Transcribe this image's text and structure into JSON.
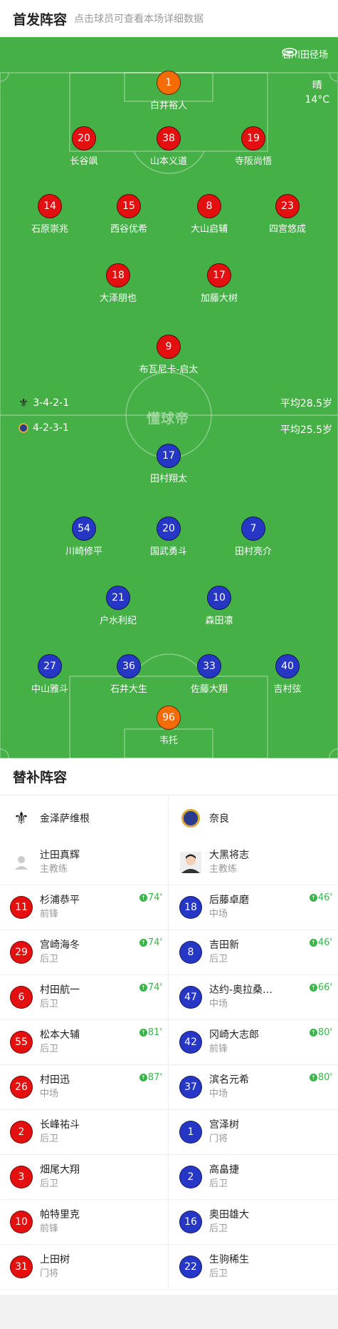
{
  "header": {
    "title": "首发阵容",
    "subtitle": "点击球员可查看本场详细数据"
  },
  "match": {
    "venue": "石川田径场",
    "weather": "晴",
    "temp": "14°C",
    "watermark": "懂球帝"
  },
  "home": {
    "formation": "3-4-2-1",
    "avg_age": "平均28.5岁"
  },
  "away": {
    "formation": "4-2-3-1",
    "avg_age": "平均25.5岁"
  },
  "home_players": [
    {
      "num": "1",
      "name": "白井裕人",
      "gk": true
    },
    {
      "num": "20",
      "name": "长谷飒",
      "sub": "81'",
      "goal": true
    },
    {
      "num": "38",
      "name": "山本义道",
      "captain": true
    },
    {
      "num": "19",
      "name": "寺阪尚悟"
    },
    {
      "num": "14",
      "name": "石原崇兆",
      "sub": "74'"
    },
    {
      "num": "15",
      "name": "西谷优希"
    },
    {
      "num": "8",
      "name": "大山启辅",
      "sub": "87'",
      "goal": true
    },
    {
      "num": "23",
      "name": "四宫悠成"
    },
    {
      "num": "18",
      "name": "大泽朋也",
      "sub": "74'"
    },
    {
      "num": "17",
      "name": "加藤大树",
      "sub": "74'"
    },
    {
      "num": "9",
      "name": "布瓦尼卡-启太"
    }
  ],
  "away_players": [
    {
      "num": "17",
      "name": "田村翔太",
      "sub": "80'"
    },
    {
      "num": "54",
      "name": "川崎修平",
      "sub": "80'"
    },
    {
      "num": "20",
      "name": "国武勇斗"
    },
    {
      "num": "7",
      "name": "田村亮介",
      "sub": "66'"
    },
    {
      "num": "21",
      "name": "户水利纪",
      "sub": "46'"
    },
    {
      "num": "10",
      "name": "森田凛",
      "captain": true
    },
    {
      "num": "27",
      "name": "中山雅斗",
      "sub": "46'"
    },
    {
      "num": "36",
      "name": "石井大生"
    },
    {
      "num": "33",
      "name": "佐藤大翔"
    },
    {
      "num": "40",
      "name": "吉村弦"
    },
    {
      "num": "96",
      "name": "韦托",
      "gk": true
    }
  ],
  "subs": {
    "title": "替补阵容",
    "home_team": "金泽萨维根",
    "away_team": "奈良",
    "home_coach": {
      "name": "辻田真辉",
      "role": "主教练"
    },
    "away_coach": {
      "name": "大黑将志",
      "role": "主教练"
    },
    "home": [
      {
        "num": "11",
        "name": "杉浦恭平",
        "pos": "前锋",
        "time": "74'"
      },
      {
        "num": "29",
        "name": "宫崎海冬",
        "pos": "后卫",
        "time": "74'"
      },
      {
        "num": "6",
        "name": "村田航一",
        "pos": "后卫",
        "time": "74'"
      },
      {
        "num": "55",
        "name": "松本大辅",
        "pos": "后卫",
        "time": "81'"
      },
      {
        "num": "26",
        "name": "村田迅",
        "pos": "中场",
        "time": "87'"
      },
      {
        "num": "2",
        "name": "长峰祐斗",
        "pos": "后卫"
      },
      {
        "num": "3",
        "name": "畑尾大翔",
        "pos": "后卫"
      },
      {
        "num": "10",
        "name": "帕特里克",
        "pos": "前锋"
      },
      {
        "num": "31",
        "name": "上田树",
        "pos": "门将"
      }
    ],
    "away": [
      {
        "num": "18",
        "name": "后藤卓磨",
        "pos": "中场",
        "time": "46'"
      },
      {
        "num": "8",
        "name": "吉田新",
        "pos": "后卫",
        "time": "46'"
      },
      {
        "num": "47",
        "name": "达约-奥拉桑…",
        "pos": "中场",
        "time": "66'"
      },
      {
        "num": "42",
        "name": "冈崎大志郎",
        "pos": "前锋",
        "time": "80'"
      },
      {
        "num": "37",
        "name": "滨名元希",
        "pos": "中场",
        "time": "80'"
      },
      {
        "num": "1",
        "name": "宫泽树",
        "pos": "门将"
      },
      {
        "num": "2",
        "name": "高畠捷",
        "pos": "后卫"
      },
      {
        "num": "16",
        "name": "奥田雄大",
        "pos": "后卫"
      },
      {
        "num": "22",
        "name": "生驹稀生",
        "pos": "后卫"
      }
    ]
  }
}
